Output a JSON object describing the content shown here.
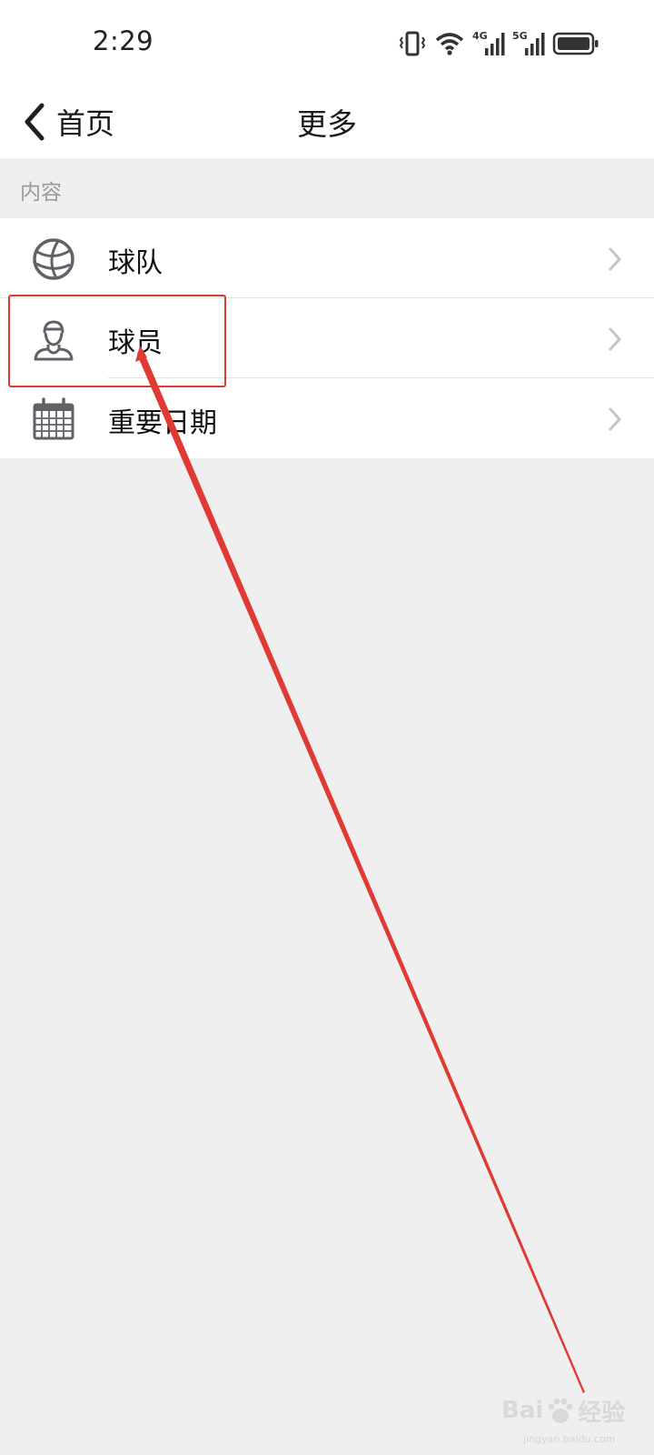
{
  "status_bar": {
    "time": "2:29",
    "network_a": "4G",
    "network_b": "5G"
  },
  "nav": {
    "back_label": "首页",
    "title": "更多"
  },
  "section": {
    "header": "内容"
  },
  "items": [
    {
      "label": "球队",
      "icon": "basketball-icon"
    },
    {
      "label": "球员",
      "icon": "player-icon"
    },
    {
      "label": "重要日期",
      "icon": "calendar-icon"
    }
  ],
  "watermark": {
    "brand_left": "Bai",
    "brand_right": "经验",
    "sub": "jingyan.baidu.com"
  },
  "colors": {
    "accent_red": "#e03a34",
    "icon_gray": "#5f6368",
    "background": "#efefef"
  }
}
